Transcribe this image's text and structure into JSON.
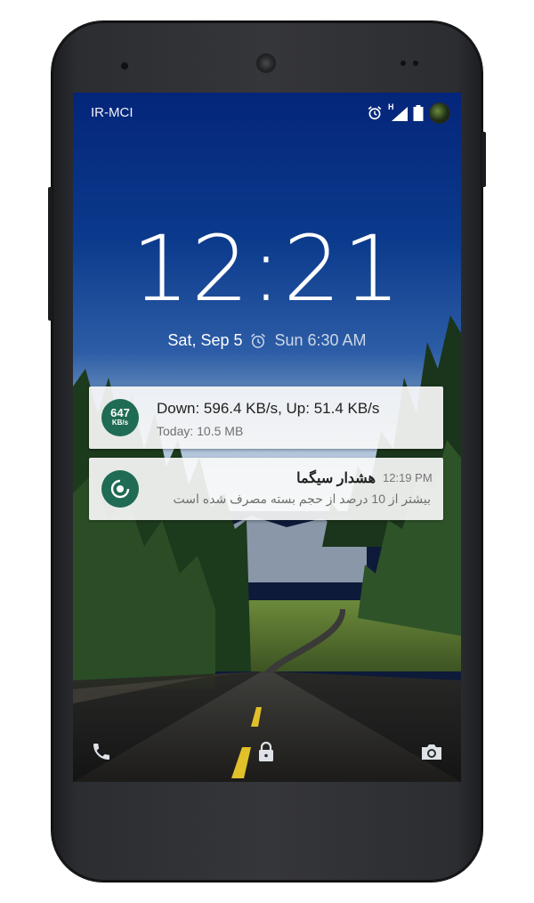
{
  "status_bar": {
    "carrier": "IR-MCI",
    "icons": [
      "alarm-icon",
      "signal-h-icon",
      "battery-icon",
      "avatar"
    ],
    "network_type": "H"
  },
  "lockscreen": {
    "time": "12:21",
    "date": "Sat, Sep 5",
    "next_alarm": "Sun 6:30 AM"
  },
  "notifications": [
    {
      "app_icon": "speed-meter-icon",
      "icon_value": "647",
      "icon_unit": "KB/s",
      "icon_color": "#1f6b53",
      "title": "Down: 596.4 KB/s, Up: 51.4 KB/s",
      "text": "Today: 10.5 MB"
    },
    {
      "app_icon": "sigma-app-icon",
      "icon_color": "#1f6b53",
      "time": "12:19 PM",
      "title": "هشدار سیگما",
      "text": "بیشتر از 10 درصد از حجم بسته مصرف شده است"
    }
  ],
  "bottom_shortcuts": [
    "phone-icon",
    "lock-icon",
    "camera-icon"
  ]
}
